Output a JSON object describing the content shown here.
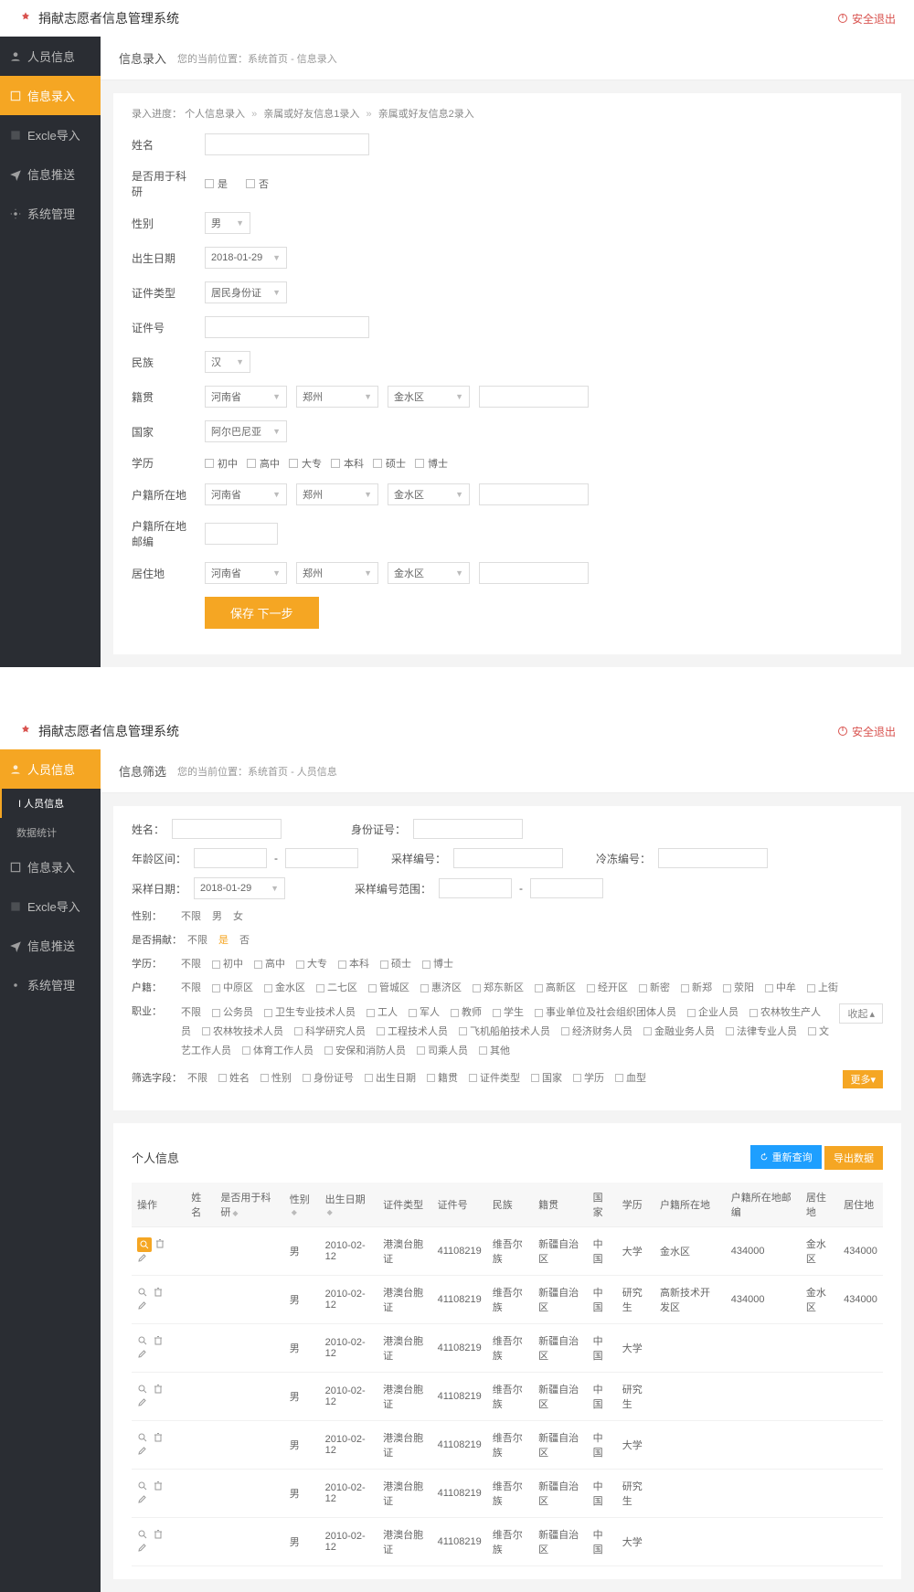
{
  "brand": "捐献志愿者信息管理系统",
  "logout": "安全退出",
  "sidebar": {
    "items": [
      {
        "label": "人员信息"
      },
      {
        "label": "信息录入"
      },
      {
        "label": "Excle导入"
      },
      {
        "label": "信息推送"
      },
      {
        "label": "系统管理"
      }
    ],
    "subs": [
      {
        "label": "I 人员信息"
      },
      {
        "label": "数据统计"
      }
    ]
  },
  "panel1": {
    "crumb_title": "信息录入",
    "crumb_path": "您的当前位置：系统首页 - 信息录入",
    "progress_prefix": "录入进度：",
    "progress_steps": [
      "个人信息录入",
      "亲属或好友信息1录入",
      "亲属或好友信息2录入"
    ],
    "fields": {
      "name_label": "姓名",
      "research_label": "是否用于科研",
      "research_opts": [
        "是",
        "否"
      ],
      "gender_label": "性别",
      "gender_value": "男",
      "birth_label": "出生日期",
      "birth_value": "2018-01-29",
      "idtype_label": "证件类型",
      "idtype_value": "居民身份证",
      "idno_label": "证件号",
      "ethnic_label": "民族",
      "ethnic_value": "汉",
      "native_label": "籍贯",
      "native_province": "河南省",
      "native_city": "郑州",
      "native_district": "金水区",
      "country_label": "国家",
      "country_value": "阿尔巴尼亚",
      "edu_label": "学历",
      "edu_opts": [
        "初中",
        "高中",
        "大专",
        "本科",
        "硕士",
        "博士"
      ],
      "hukou_label": "户籍所在地",
      "hukou_province": "河南省",
      "hukou_city": "郑州",
      "hukou_district": "金水区",
      "hukou_zip_label": "户籍所在地邮编",
      "live_label": "居住地",
      "live_province": "河南省",
      "live_city": "郑州",
      "live_district": "金水区",
      "save_btn": "保存 下一步"
    }
  },
  "panel2": {
    "crumb_title": "信息筛选",
    "crumb_path": "您的当前位置：系统首页 - 人员信息",
    "filters": {
      "name_label": "姓名：",
      "idno_label": "身份证号：",
      "age_label": "年龄区间：",
      "sample_no_label": "采样编号：",
      "freeze_no_label": "冷冻编号：",
      "sample_date_label": "采样日期：",
      "sample_date_value": "2018-01-29",
      "sample_range_label": "采样编号范围：",
      "gender_label": "性别：",
      "gender_opts": [
        "不限",
        "男",
        "女"
      ],
      "donate_label": "是否捐献：",
      "donate_opts": [
        "不限",
        "是",
        "否"
      ],
      "donate_active": "是",
      "edu_label": "学历：",
      "edu_opts": [
        "不限",
        "初中",
        "高中",
        "大专",
        "本科",
        "硕士",
        "博士"
      ],
      "hukou_label": "户籍：",
      "hukou_opts": [
        "不限",
        "中原区",
        "金水区",
        "二七区",
        "管城区",
        "惠济区",
        "郑东新区",
        "高新区",
        "经开区",
        "新密",
        "新郑",
        "荥阳",
        "中牟",
        "上街"
      ],
      "job_label": "职业：",
      "job_opts": [
        "不限",
        "公务员",
        "卫生专业技术人员",
        "工人",
        "军人",
        "教师",
        "学生",
        "事业单位及社会组织团体人员",
        "企业人员",
        "农林牧生产人员",
        "农林牧技术人员",
        "科学研究人员",
        "工程技术人员",
        "飞机船舶技术人员",
        "经济财务人员",
        "金融业务人员",
        "法律专业人员",
        "文艺工作人员",
        "体育工作人员",
        "安保和消防人员",
        "司乘人员",
        "其他"
      ],
      "collapse": "收起",
      "field_label": "筛选字段：",
      "field_opts": [
        "不限",
        "姓名",
        "性别",
        "身份证号",
        "出生日期",
        "籍贯",
        "证件类型",
        "国家",
        "学历",
        "血型"
      ],
      "more": "更多"
    },
    "table": {
      "title": "个人信息",
      "refresh_btn": "重新查询",
      "export_btn": "导出数据",
      "cols": [
        "操作",
        "姓名",
        "是否用于科研",
        "性别",
        "出生日期",
        "证件类型",
        "证件号",
        "民族",
        "籍贯",
        "国家",
        "学历",
        "户籍所在地",
        "户籍所在地邮编",
        "居住地",
        "居住地"
      ],
      "rows": [
        {
          "gender": "男",
          "birth": "2010-02-12",
          "idtype": "港澳台胞证",
          "idno": "41108219",
          "ethnic": "维吾尔族",
          "native": "新疆自治区",
          "country": "中国",
          "edu": "大学",
          "hukou": "金水区",
          "zip": "434000",
          "live": "金水区",
          "live2": "434000",
          "hl": true
        },
        {
          "gender": "男",
          "birth": "2010-02-12",
          "idtype": "港澳台胞证",
          "idno": "41108219",
          "ethnic": "维吾尔族",
          "native": "新疆自治区",
          "country": "中国",
          "edu": "研究生",
          "hukou": "高新技术开发区",
          "zip": "434000",
          "live": "金水区",
          "live2": "434000"
        },
        {
          "gender": "男",
          "birth": "2010-02-12",
          "idtype": "港澳台胞证",
          "idno": "41108219",
          "ethnic": "维吾尔族",
          "native": "新疆自治区",
          "country": "中国",
          "edu": "大学"
        },
        {
          "gender": "男",
          "birth": "2010-02-12",
          "idtype": "港澳台胞证",
          "idno": "41108219",
          "ethnic": "维吾尔族",
          "native": "新疆自治区",
          "country": "中国",
          "edu": "研究生"
        },
        {
          "gender": "男",
          "birth": "2010-02-12",
          "idtype": "港澳台胞证",
          "idno": "41108219",
          "ethnic": "维吾尔族",
          "native": "新疆自治区",
          "country": "中国",
          "edu": "大学"
        },
        {
          "gender": "男",
          "birth": "2010-02-12",
          "idtype": "港澳台胞证",
          "idno": "41108219",
          "ethnic": "维吾尔族",
          "native": "新疆自治区",
          "country": "中国",
          "edu": "研究生"
        },
        {
          "gender": "男",
          "birth": "2010-02-12",
          "idtype": "港澳台胞证",
          "idno": "41108219",
          "ethnic": "维吾尔族",
          "native": "新疆自治区",
          "country": "中国",
          "edu": "大学"
        }
      ]
    }
  }
}
